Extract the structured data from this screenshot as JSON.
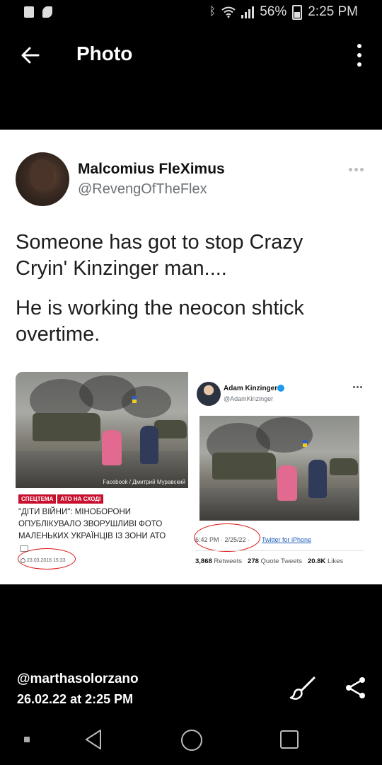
{
  "status_bar": {
    "battery": "56%",
    "time": "2:25 PM"
  },
  "header": {
    "title": "Photo"
  },
  "tweet": {
    "author_name": "Malcomius FleXimus",
    "author_handle": "@RevengOfTheFlex",
    "text_line1": "Someone has got to stop Crazy Cryin' Kinzinger man....",
    "text_line2": "He is working the neocon shtick overtime."
  },
  "embedded_article": {
    "photo_credit": "Facebook / Дмитрий Муравский",
    "tag1": "СПЕЦТЕМА",
    "tag2": "АТО НА СХОДІ",
    "headline": "\"ДІТИ ВІЙНИ\": МІНОБОРОНИ ОПУБЛІКУВАЛО ЗВОРУШЛИВІ ФОТО МАЛЕНЬКИХ УКРАЇНЦІВ ІЗ ЗОНИ АТО",
    "date": "23.03.2016 15:33"
  },
  "embedded_tweet": {
    "name": "Adam Kinzinger",
    "handle": "@AdamKinzinger",
    "meta": "6:42 PM · 2/25/22 ·",
    "source": "Twitter for iPhone",
    "retweets_count": "3,868",
    "retweets_label": "Retweets",
    "quotes_count": "278",
    "quotes_label": "Quote Tweets",
    "likes_count": "20.8K",
    "likes_label": "Likes"
  },
  "footer": {
    "user": "@marthasolorzano",
    "date": "26.02.22 at 2:25 PM"
  },
  "colors": {
    "background": "#000000",
    "card": "#ffffff",
    "handle_gray": "#6b7177",
    "annotation_red": "#dd1111",
    "verified_blue": "#1d9bf0"
  }
}
